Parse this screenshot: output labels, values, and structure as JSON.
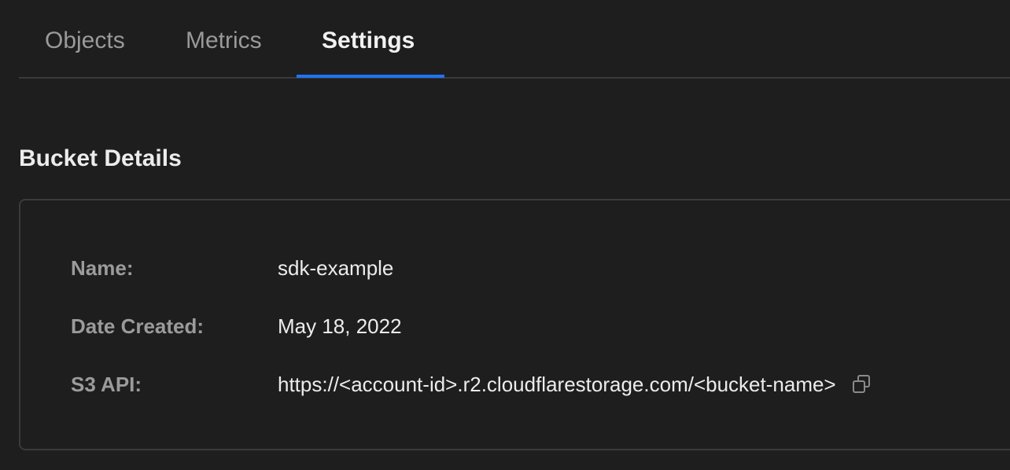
{
  "tabs": [
    {
      "label": "Objects",
      "active": false
    },
    {
      "label": "Metrics",
      "active": false
    },
    {
      "label": "Settings",
      "active": true
    }
  ],
  "accent_color": "#1d74f5",
  "section": {
    "title": "Bucket Details"
  },
  "details": {
    "name_label": "Name:",
    "name_value": "sdk-example",
    "date_label": "Date Created:",
    "date_value": "May 18, 2022",
    "api_label": "S3 API:",
    "api_value": "https://<account-id>.r2.cloudflarestorage.com/<bucket-name>",
    "copy_icon": "copy-icon"
  }
}
